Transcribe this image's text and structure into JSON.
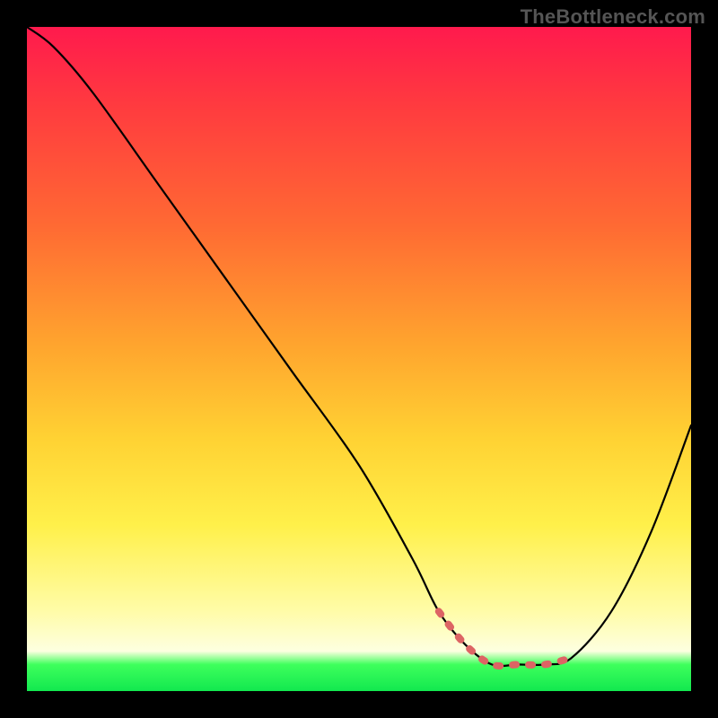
{
  "watermark": "TheBottleneck.com",
  "chart_data": {
    "type": "line",
    "title": "",
    "xlabel": "",
    "ylabel": "",
    "xlim": [
      0,
      100
    ],
    "ylim": [
      0,
      100
    ],
    "series": [
      {
        "name": "bottleneck-curve",
        "color": "#000000",
        "x": [
          0,
          4,
          10,
          20,
          30,
          40,
          50,
          58,
          62,
          66,
          70,
          74,
          78,
          82,
          88,
          94,
          100
        ],
        "y": [
          100,
          97,
          90,
          76,
          62,
          48,
          34,
          20,
          12,
          7,
          4,
          4,
          4,
          5,
          12,
          24,
          40
        ]
      },
      {
        "name": "optimal-range",
        "color": "#e05a5a",
        "x": [
          62,
          66,
          70,
          74,
          78,
          82
        ],
        "y": [
          12,
          7,
          4,
          4,
          4,
          5
        ]
      }
    ],
    "gradient_stops": [
      {
        "pos": 0.0,
        "color": "#ff1a4d"
      },
      {
        "pos": 0.12,
        "color": "#ff3b3f"
      },
      {
        "pos": 0.3,
        "color": "#ff6a33"
      },
      {
        "pos": 0.48,
        "color": "#ffa52e"
      },
      {
        "pos": 0.62,
        "color": "#ffd233"
      },
      {
        "pos": 0.75,
        "color": "#fff04a"
      },
      {
        "pos": 0.88,
        "color": "#fffca8"
      },
      {
        "pos": 0.94,
        "color": "#fdffe0"
      },
      {
        "pos": 0.96,
        "color": "#3eff5c"
      },
      {
        "pos": 1.0,
        "color": "#12e84f"
      }
    ]
  }
}
